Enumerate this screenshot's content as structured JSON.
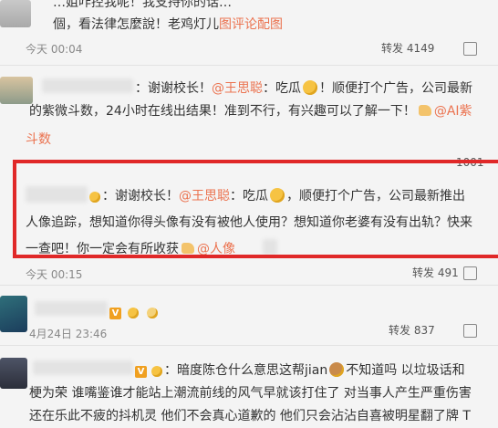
{
  "thread": {
    "c1": {
      "line1": "…姐咋控我呢！我支持你的话…",
      "line2": "個，看法律怎麼說！老鸡灯儿",
      "img_link": "图评论配图",
      "time": "今天 00:04",
      "forward": "转发 4149"
    },
    "c2": {
      "line1_a": "：谢谢校长！",
      "mention": "@王思聪",
      "line1_b": "：吃瓜",
      "line1_c": "！顺便打个广告，公司最新",
      "line2": "的紫微斗数，24小时在线出结果！准到不行，有兴趣可以了解一下！",
      "ai_mention": "@AI紫",
      "line3": "斗数",
      "stat_tail": "1001"
    },
    "c3": {
      "line1_a": "：谢谢校长！",
      "mention": "@王思聪",
      "line1_b": "：吃瓜",
      "line1_c": "，顺便打个广告，公司最新推出",
      "line2": "人像追踪，想知道你得头像有没有被他人使用？想知道你老婆有没有出轨？快来",
      "line3": "一查吧！你一定会有所收获",
      "mention2": "@人像",
      "time": "今天 00:15",
      "forward": "转发 491"
    },
    "c4": {
      "badge": "V",
      "time": "4月24日 23:46",
      "forward": "转发 837"
    },
    "c5": {
      "line1_a": "：暗度陈仓什么意思这帮jian",
      "line1_b": "不知道吗 以垃圾话和",
      "line2": "梗为荣 谁嘴鉴谁才能站上潮流前线的风气早就该打住了 对当事人产生严重伤害",
      "line3": "还在乐此不疲的抖机灵 他们不会真心道歉的 他们只会沾沾自喜被明星翻了牌 T"
    }
  }
}
